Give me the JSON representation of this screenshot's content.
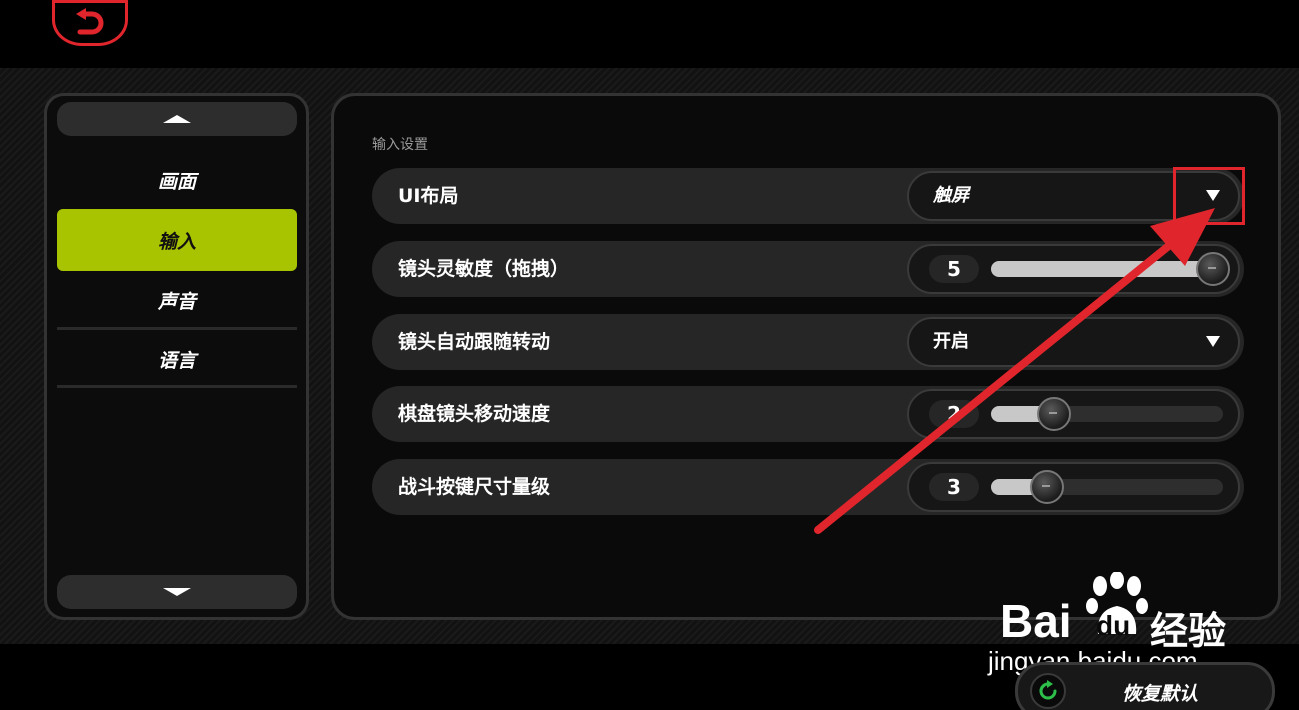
{
  "nav": {
    "items": [
      {
        "label": "画面"
      },
      {
        "label": "输入"
      },
      {
        "label": "声音"
      },
      {
        "label": "语言"
      }
    ],
    "active_index": 1
  },
  "panel": {
    "section_title": "输入设置",
    "rows": [
      {
        "label": "UI布局",
        "control": "dropdown",
        "value": "触屏"
      },
      {
        "label": "镜头灵敏度（拖拽）",
        "control": "slider",
        "value": "5",
        "fraction": 1.0
      },
      {
        "label": "镜头自动跟随转动",
        "control": "dropdown",
        "value": "开启"
      },
      {
        "label": "棋盘镜头移动速度",
        "control": "slider",
        "value": "2",
        "fraction": 0.27
      },
      {
        "label": "战斗按键尺寸量级",
        "control": "slider",
        "value": "3",
        "fraction": 0.24
      }
    ]
  },
  "footer": {
    "reset_label": "恢复默认"
  },
  "watermark": {
    "brand": "Bai",
    "brand_suffix": "du",
    "product": "经验",
    "url": "jingyan.baidu.com"
  },
  "icons": {
    "back": "back-arrow-icon",
    "scroll_up": "triangle-up-icon",
    "scroll_down": "triangle-down-icon",
    "dropdown": "caret-down-icon",
    "reset": "refresh-icon"
  },
  "colors": {
    "accent": "#a8c300",
    "annotation": "#e0262c",
    "reset_icon": "#2dbf4a"
  }
}
